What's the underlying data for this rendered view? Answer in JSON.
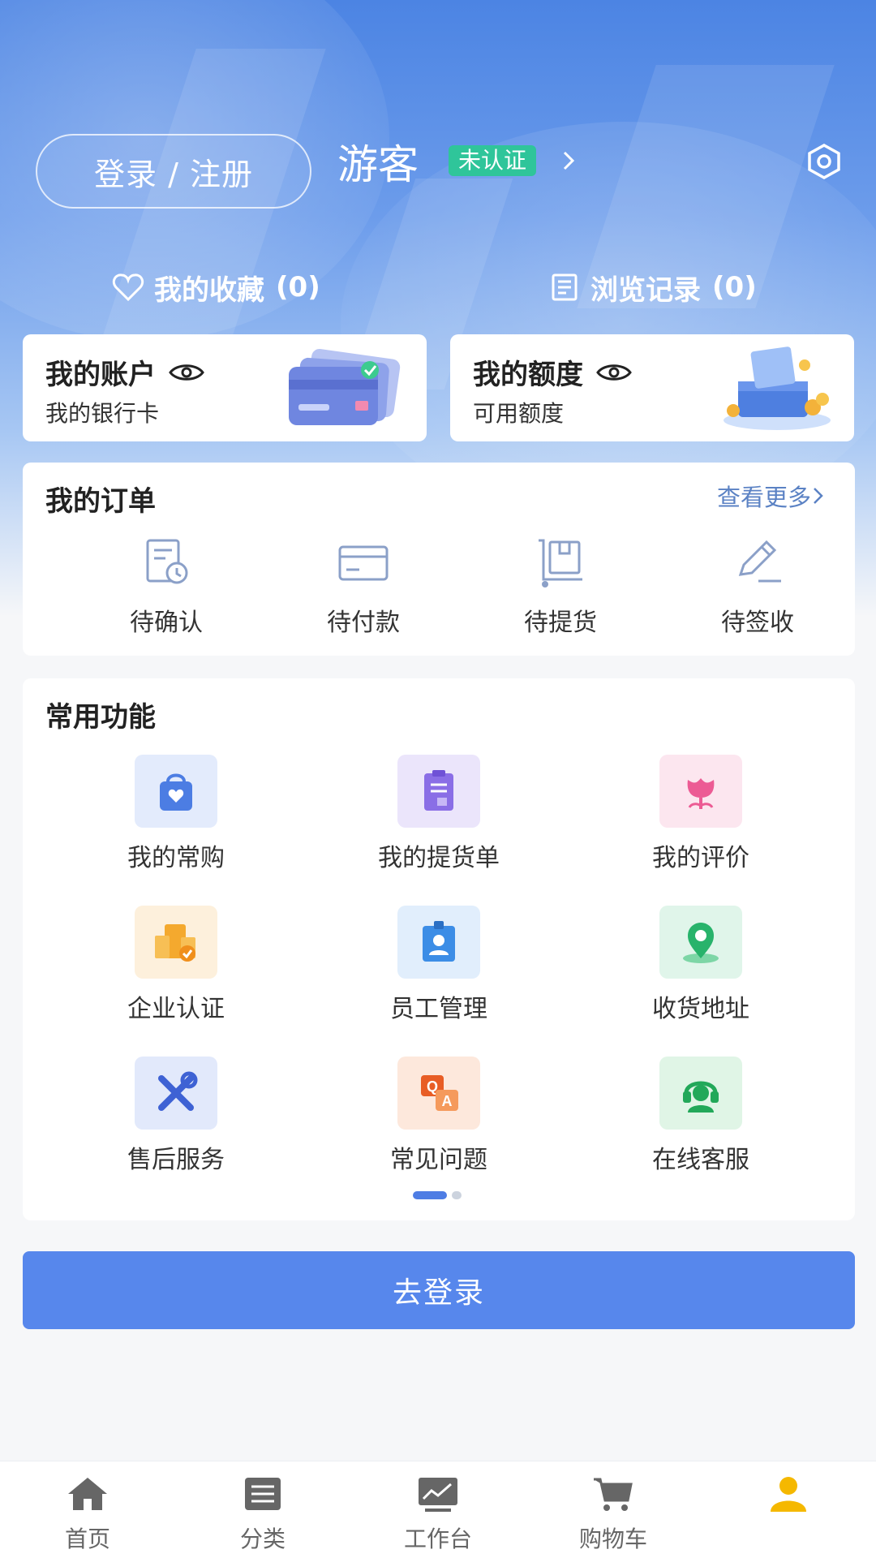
{
  "header": {
    "login_button": "登录 / 注册",
    "guest_name": "游客",
    "auth_badge": "未认证",
    "favorites_label": "我的收藏",
    "favorites_count": "(0)",
    "history_label": "浏览记录",
    "history_count": "(0)"
  },
  "account_cards": [
    {
      "title": "我的账户",
      "subtitle": "我的银行卡"
    },
    {
      "title": "我的额度",
      "subtitle": "可用额度"
    }
  ],
  "orders": {
    "title": "我的订单",
    "see_more": "查看更多",
    "items": [
      {
        "label": "待确认",
        "icon": "receipt-clock-icon"
      },
      {
        "label": "待付款",
        "icon": "card-icon"
      },
      {
        "label": "待提货",
        "icon": "box-cart-icon"
      },
      {
        "label": "待签收",
        "icon": "pen-sign-icon"
      }
    ]
  },
  "functions": {
    "title": "常用功能",
    "items": [
      {
        "label": "我的常购",
        "icon": "shopping-bag-icon"
      },
      {
        "label": "我的提货单",
        "icon": "clipboard-icon"
      },
      {
        "label": "我的评价",
        "icon": "flower-icon"
      },
      {
        "label": "企业认证",
        "icon": "enterprise-icon"
      },
      {
        "label": "员工管理",
        "icon": "id-badge-icon"
      },
      {
        "label": "收货地址",
        "icon": "location-pin-icon"
      },
      {
        "label": "售后服务",
        "icon": "tools-icon"
      },
      {
        "label": "常见问题",
        "icon": "qa-icon"
      },
      {
        "label": "在线客服",
        "icon": "headset-icon"
      }
    ],
    "page_indicator": {
      "current": 1,
      "total": 2
    }
  },
  "go_login_button": "去登录",
  "tabbar": {
    "items": [
      {
        "label": "首页",
        "icon": "home-icon"
      },
      {
        "label": "分类",
        "icon": "list-icon"
      },
      {
        "label": "工作台",
        "icon": "chart-icon"
      },
      {
        "label": "购物车",
        "icon": "cart-icon"
      },
      {
        "label": "",
        "icon": "user-icon",
        "active": true
      }
    ]
  },
  "colors": {
    "accent": "#5787ec",
    "badge": "#2fc59a",
    "active_tab": "#f5b800"
  }
}
